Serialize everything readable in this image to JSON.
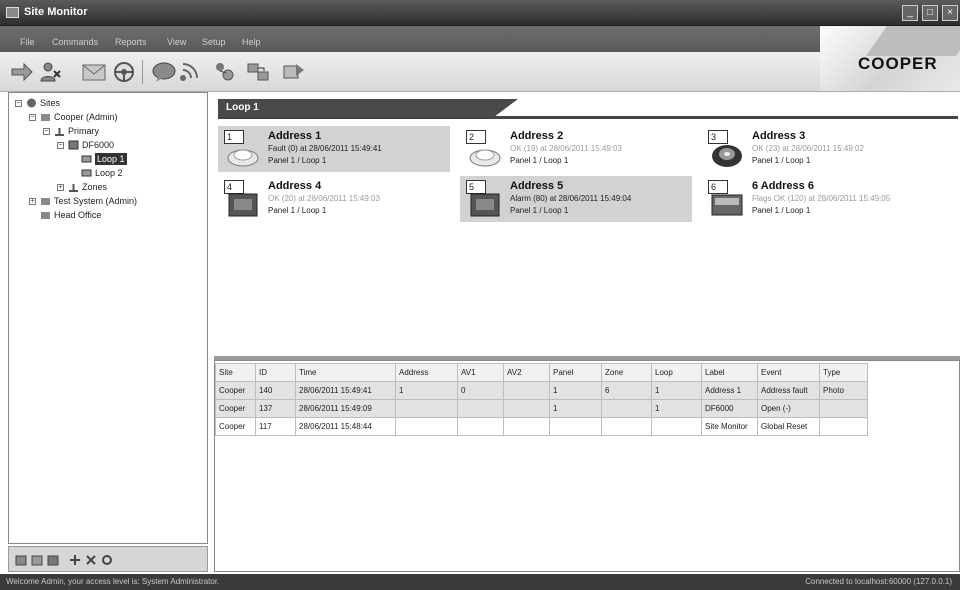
{
  "window": {
    "title": "Site Monitor"
  },
  "menu": [
    "File",
    "Commands",
    "Reports",
    "View",
    "Setup",
    "Help"
  ],
  "toolbar": {
    "icons": [
      "forward-icon",
      "user-alert-icon",
      "mail-icon",
      "steering-icon",
      "chat-icon",
      "signal-icon",
      "network-icon",
      "transfer-icon",
      "reset-icon"
    ]
  },
  "brand": {
    "logo": "COOPER"
  },
  "tree": {
    "sites": "Sites",
    "cooper": "Cooper (Admin)",
    "primary": "Primary",
    "df6000": "DF6000",
    "loop1": "Loop 1",
    "loop2": "Loop 2",
    "zones": "Zones",
    "test_system": "Test System (Admin)",
    "head_office": "Head Office"
  },
  "panel": {
    "tab": "Loop 1"
  },
  "devices": [
    {
      "num": "1",
      "name": "Address 1",
      "status": "Fault (0) at 28/06/2011 15:49:41",
      "location": "Panel 1 / Loop 1"
    },
    {
      "num": "2",
      "name": "Address 2",
      "status": "OK (19) at 28/06/2011 15:49:03",
      "location": "Panel 1 / Loop 1"
    },
    {
      "num": "3",
      "name": "Address 3",
      "status": "OK (23) at 28/06/2011 15:49:02",
      "location": "Panel 1 / Loop 1"
    },
    {
      "num": "4",
      "name": "Address 4",
      "status": "OK (20) at 28/06/2011 15:49:03",
      "location": "Panel 1 / Loop 1"
    },
    {
      "num": "5",
      "name": "Address 5",
      "status": "Alarm (80) at 28/06/2011 15:49:04",
      "location": "Panel 1 / Loop 1"
    },
    {
      "num": "6",
      "name": "6 Address 6",
      "status": "Flags OK (120) at 28/06/2011 15:49:05",
      "location": "Panel 1 / Loop 1"
    }
  ],
  "events": {
    "columns": [
      "Site",
      "ID",
      "Time",
      "Address",
      "AV1",
      "AV2",
      "Panel",
      "Zone",
      "Loop",
      "Label",
      "Event",
      "Type"
    ],
    "rows": [
      [
        "Cooper",
        "140",
        "28/06/2011 15:49:41",
        "1",
        "0",
        "",
        "1",
        "6",
        "1",
        "Address 1",
        "Address fault",
        "Photo"
      ],
      [
        "Cooper",
        "137",
        "28/06/2011 15:49:09",
        "",
        "",
        "",
        "1",
        "",
        "1",
        "DF6000",
        "Open (-)",
        ""
      ],
      [
        "Cooper",
        "117",
        "28/06/2011 15:48:44",
        "",
        "",
        "",
        "",
        "",
        "",
        "Site Monitor",
        "Global Reset",
        ""
      ]
    ]
  },
  "status": {
    "left": "Welcome Admin, your access level is: System Administrator.",
    "right": "Connected to localhost:60000 (127.0.0.1)"
  }
}
